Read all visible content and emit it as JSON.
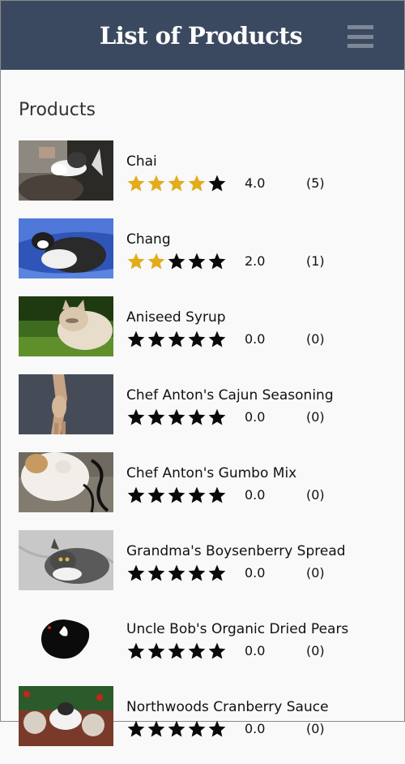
{
  "header": {
    "title": "List of Products",
    "menu_icon": "hamburger-menu-icon"
  },
  "section": {
    "heading": "Products"
  },
  "colors": {
    "header_bg": "#3b4960",
    "star_filled": "#e2ac1a",
    "star_empty": "#0a0a0a"
  },
  "products": [
    {
      "name": "Chai",
      "rating": 4,
      "rating_text": "4.0",
      "count_text": "(5)",
      "thumb": "cat-on-scratching-post"
    },
    {
      "name": "Chang",
      "rating": 2,
      "rating_text": "2.0",
      "count_text": "(1)",
      "thumb": "cat-on-blue-bed"
    },
    {
      "name": "Aniseed Syrup",
      "rating": 0,
      "rating_text": "0.0",
      "count_text": "(0)",
      "thumb": "cat-in-grass"
    },
    {
      "name": "Chef Anton's Cajun Seasoning",
      "rating": 0,
      "rating_text": "0.0",
      "count_text": "(0)",
      "thumb": "cat-standing-on-wall"
    },
    {
      "name": "Chef Anton's Gumbo Mix",
      "rating": 0,
      "rating_text": "0.0",
      "count_text": "(0)",
      "thumb": "white-cat-near-chair"
    },
    {
      "name": "Grandma's Boysenberry Spread",
      "rating": 0,
      "rating_text": "0.0",
      "count_text": "(0)",
      "thumb": "grey-cat-lying"
    },
    {
      "name": "Uncle Bob's Organic Dried Pears",
      "rating": 0,
      "rating_text": "0.0",
      "count_text": "(0)",
      "thumb": "black-cat-silhouette"
    },
    {
      "name": "Northwoods Cranberry Sauce",
      "rating": 0,
      "rating_text": "0.0",
      "count_text": "(0)",
      "thumb": "cat-at-christmas-table"
    }
  ]
}
